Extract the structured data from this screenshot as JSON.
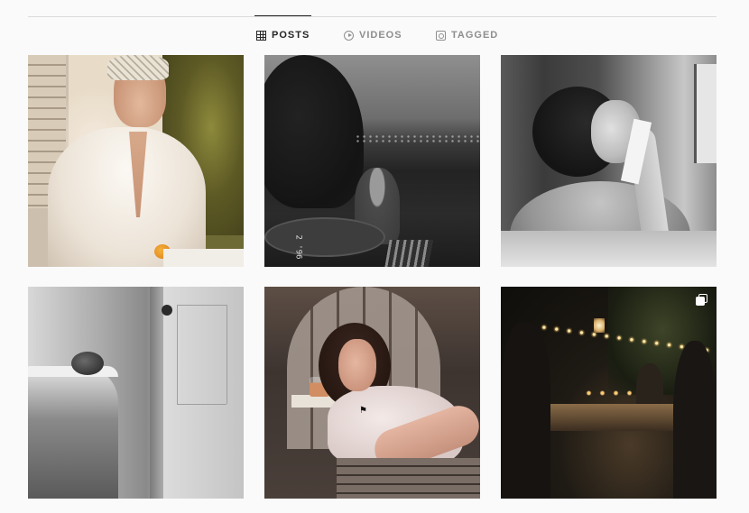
{
  "tabs": [
    {
      "label": "POSTS",
      "icon": "grid-icon",
      "active": true
    },
    {
      "label": "VIDEOS",
      "icon": "play-icon",
      "active": false
    },
    {
      "label": "TAGGED",
      "icon": "tag-icon",
      "active": false
    }
  ],
  "posts": [
    {
      "kind": "photo"
    },
    {
      "kind": "photo",
      "stamp": "2 '96"
    },
    {
      "kind": "photo"
    },
    {
      "kind": "photo"
    },
    {
      "kind": "photo"
    },
    {
      "kind": "carousel",
      "icon": "multiple-images-icon"
    }
  ],
  "colors": {
    "background": "#fafafa",
    "divider": "#dbdbdb",
    "active_tab": "#262626",
    "inactive_tab": "#8e8e8e"
  }
}
